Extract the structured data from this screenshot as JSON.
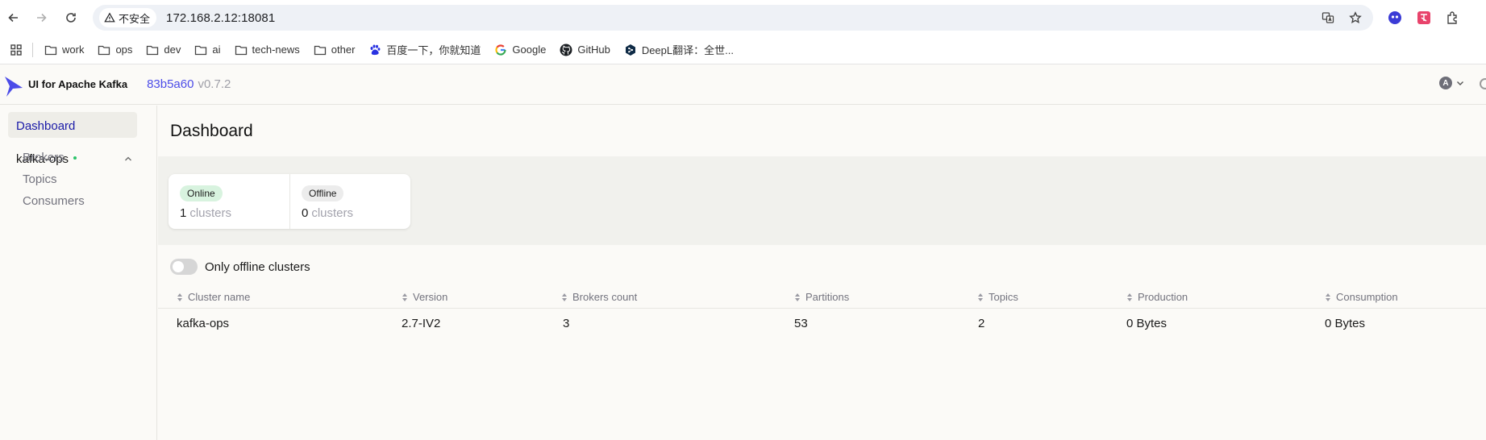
{
  "browser": {
    "security_label": "不安全",
    "url": "172.168.2.12:18081",
    "bookmarks": [
      {
        "label": "work",
        "icon": "folder-icon"
      },
      {
        "label": "ops",
        "icon": "folder-icon"
      },
      {
        "label": "dev",
        "icon": "folder-icon"
      },
      {
        "label": "ai",
        "icon": "folder-icon"
      },
      {
        "label": "tech-news",
        "icon": "folder-icon"
      },
      {
        "label": "other",
        "icon": "folder-icon"
      },
      {
        "label": "百度一下，你就知道",
        "icon": "baidu-icon"
      },
      {
        "label": "Google",
        "icon": "google-icon"
      },
      {
        "label": "GitHub",
        "icon": "github-icon"
      },
      {
        "label": "DeepL翻译：全世...",
        "icon": "deepl-icon"
      }
    ]
  },
  "header": {
    "brand": "UI for Apache Kafka",
    "version_hash": "83b5a60",
    "version_number": "v0.7.2",
    "user_initial": "A"
  },
  "sidebar": {
    "dashboard_label": "Dashboard",
    "cluster_name": "kafka-ops",
    "cluster_items": [
      "Brokers",
      "Topics",
      "Consumers"
    ]
  },
  "main": {
    "title": "Dashboard",
    "metrics": {
      "online": {
        "label": "Online",
        "value": "1",
        "unit": "clusters"
      },
      "offline": {
        "label": "Offline",
        "value": "0",
        "unit": "clusters"
      }
    },
    "toggle_label": "Only offline clusters",
    "table": {
      "headers": [
        "Cluster name",
        "Version",
        "Brokers count",
        "Partitions",
        "Topics",
        "Production",
        "Consumption"
      ],
      "rows": [
        [
          "kafka-ops",
          "2.7-IV2",
          "3",
          "53",
          "2",
          "0 Bytes",
          "0 Bytes"
        ]
      ]
    }
  },
  "colors": {
    "accent": "#4c4ce8",
    "online_badge": "#d8f3df",
    "status_online": "#2cc36b"
  }
}
